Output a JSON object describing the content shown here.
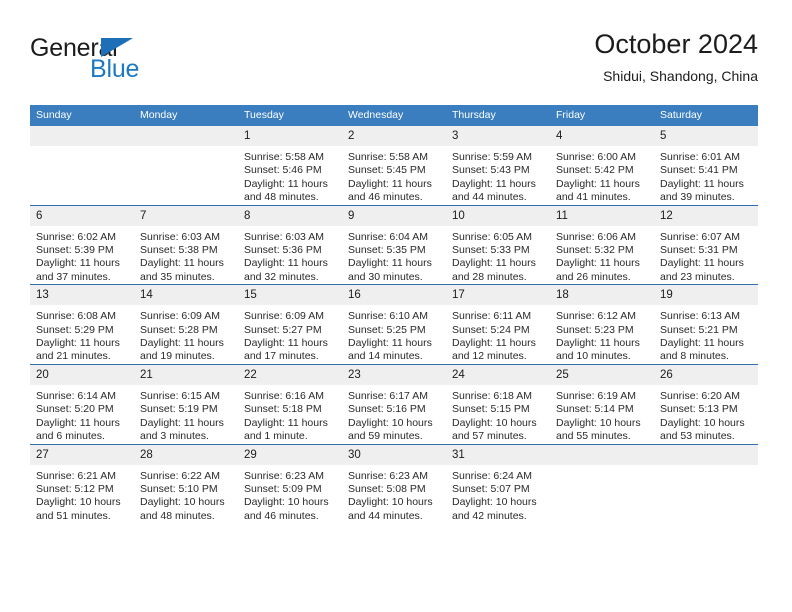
{
  "brand": {
    "name_top": "General",
    "name_bottom": "Blue",
    "accent_color": "#1d79c4",
    "triangle_color": "#1d6fb8"
  },
  "header": {
    "title": "October 2024",
    "subtitle": "Shidui, Shandong, China",
    "header_bg": "#3a7ebf",
    "header_text_color": "#ffffff",
    "daynum_bg": "#efefef",
    "row_divider_color": "#2f6fae"
  },
  "weekdays": [
    "Sunday",
    "Monday",
    "Tuesday",
    "Wednesday",
    "Thursday",
    "Friday",
    "Saturday"
  ],
  "weeks": [
    [
      {
        "day": "",
        "sunrise": "",
        "sunset": "",
        "daylight1": "",
        "daylight2": ""
      },
      {
        "day": "",
        "sunrise": "",
        "sunset": "",
        "daylight1": "",
        "daylight2": ""
      },
      {
        "day": "1",
        "sunrise": "Sunrise: 5:58 AM",
        "sunset": "Sunset: 5:46 PM",
        "daylight1": "Daylight: 11 hours",
        "daylight2": "and 48 minutes."
      },
      {
        "day": "2",
        "sunrise": "Sunrise: 5:58 AM",
        "sunset": "Sunset: 5:45 PM",
        "daylight1": "Daylight: 11 hours",
        "daylight2": "and 46 minutes."
      },
      {
        "day": "3",
        "sunrise": "Sunrise: 5:59 AM",
        "sunset": "Sunset: 5:43 PM",
        "daylight1": "Daylight: 11 hours",
        "daylight2": "and 44 minutes."
      },
      {
        "day": "4",
        "sunrise": "Sunrise: 6:00 AM",
        "sunset": "Sunset: 5:42 PM",
        "daylight1": "Daylight: 11 hours",
        "daylight2": "and 41 minutes."
      },
      {
        "day": "5",
        "sunrise": "Sunrise: 6:01 AM",
        "sunset": "Sunset: 5:41 PM",
        "daylight1": "Daylight: 11 hours",
        "daylight2": "and 39 minutes."
      }
    ],
    [
      {
        "day": "6",
        "sunrise": "Sunrise: 6:02 AM",
        "sunset": "Sunset: 5:39 PM",
        "daylight1": "Daylight: 11 hours",
        "daylight2": "and 37 minutes."
      },
      {
        "day": "7",
        "sunrise": "Sunrise: 6:03 AM",
        "sunset": "Sunset: 5:38 PM",
        "daylight1": "Daylight: 11 hours",
        "daylight2": "and 35 minutes."
      },
      {
        "day": "8",
        "sunrise": "Sunrise: 6:03 AM",
        "sunset": "Sunset: 5:36 PM",
        "daylight1": "Daylight: 11 hours",
        "daylight2": "and 32 minutes."
      },
      {
        "day": "9",
        "sunrise": "Sunrise: 6:04 AM",
        "sunset": "Sunset: 5:35 PM",
        "daylight1": "Daylight: 11 hours",
        "daylight2": "and 30 minutes."
      },
      {
        "day": "10",
        "sunrise": "Sunrise: 6:05 AM",
        "sunset": "Sunset: 5:33 PM",
        "daylight1": "Daylight: 11 hours",
        "daylight2": "and 28 minutes."
      },
      {
        "day": "11",
        "sunrise": "Sunrise: 6:06 AM",
        "sunset": "Sunset: 5:32 PM",
        "daylight1": "Daylight: 11 hours",
        "daylight2": "and 26 minutes."
      },
      {
        "day": "12",
        "sunrise": "Sunrise: 6:07 AM",
        "sunset": "Sunset: 5:31 PM",
        "daylight1": "Daylight: 11 hours",
        "daylight2": "and 23 minutes."
      }
    ],
    [
      {
        "day": "13",
        "sunrise": "Sunrise: 6:08 AM",
        "sunset": "Sunset: 5:29 PM",
        "daylight1": "Daylight: 11 hours",
        "daylight2": "and 21 minutes."
      },
      {
        "day": "14",
        "sunrise": "Sunrise: 6:09 AM",
        "sunset": "Sunset: 5:28 PM",
        "daylight1": "Daylight: 11 hours",
        "daylight2": "and 19 minutes."
      },
      {
        "day": "15",
        "sunrise": "Sunrise: 6:09 AM",
        "sunset": "Sunset: 5:27 PM",
        "daylight1": "Daylight: 11 hours",
        "daylight2": "and 17 minutes."
      },
      {
        "day": "16",
        "sunrise": "Sunrise: 6:10 AM",
        "sunset": "Sunset: 5:25 PM",
        "daylight1": "Daylight: 11 hours",
        "daylight2": "and 14 minutes."
      },
      {
        "day": "17",
        "sunrise": "Sunrise: 6:11 AM",
        "sunset": "Sunset: 5:24 PM",
        "daylight1": "Daylight: 11 hours",
        "daylight2": "and 12 minutes."
      },
      {
        "day": "18",
        "sunrise": "Sunrise: 6:12 AM",
        "sunset": "Sunset: 5:23 PM",
        "daylight1": "Daylight: 11 hours",
        "daylight2": "and 10 minutes."
      },
      {
        "day": "19",
        "sunrise": "Sunrise: 6:13 AM",
        "sunset": "Sunset: 5:21 PM",
        "daylight1": "Daylight: 11 hours",
        "daylight2": "and 8 minutes."
      }
    ],
    [
      {
        "day": "20",
        "sunrise": "Sunrise: 6:14 AM",
        "sunset": "Sunset: 5:20 PM",
        "daylight1": "Daylight: 11 hours",
        "daylight2": "and 6 minutes."
      },
      {
        "day": "21",
        "sunrise": "Sunrise: 6:15 AM",
        "sunset": "Sunset: 5:19 PM",
        "daylight1": "Daylight: 11 hours",
        "daylight2": "and 3 minutes."
      },
      {
        "day": "22",
        "sunrise": "Sunrise: 6:16 AM",
        "sunset": "Sunset: 5:18 PM",
        "daylight1": "Daylight: 11 hours",
        "daylight2": "and 1 minute."
      },
      {
        "day": "23",
        "sunrise": "Sunrise: 6:17 AM",
        "sunset": "Sunset: 5:16 PM",
        "daylight1": "Daylight: 10 hours",
        "daylight2": "and 59 minutes."
      },
      {
        "day": "24",
        "sunrise": "Sunrise: 6:18 AM",
        "sunset": "Sunset: 5:15 PM",
        "daylight1": "Daylight: 10 hours",
        "daylight2": "and 57 minutes."
      },
      {
        "day": "25",
        "sunrise": "Sunrise: 6:19 AM",
        "sunset": "Sunset: 5:14 PM",
        "daylight1": "Daylight: 10 hours",
        "daylight2": "and 55 minutes."
      },
      {
        "day": "26",
        "sunrise": "Sunrise: 6:20 AM",
        "sunset": "Sunset: 5:13 PM",
        "daylight1": "Daylight: 10 hours",
        "daylight2": "and 53 minutes."
      }
    ],
    [
      {
        "day": "27",
        "sunrise": "Sunrise: 6:21 AM",
        "sunset": "Sunset: 5:12 PM",
        "daylight1": "Daylight: 10 hours",
        "daylight2": "and 51 minutes."
      },
      {
        "day": "28",
        "sunrise": "Sunrise: 6:22 AM",
        "sunset": "Sunset: 5:10 PM",
        "daylight1": "Daylight: 10 hours",
        "daylight2": "and 48 minutes."
      },
      {
        "day": "29",
        "sunrise": "Sunrise: 6:23 AM",
        "sunset": "Sunset: 5:09 PM",
        "daylight1": "Daylight: 10 hours",
        "daylight2": "and 46 minutes."
      },
      {
        "day": "30",
        "sunrise": "Sunrise: 6:23 AM",
        "sunset": "Sunset: 5:08 PM",
        "daylight1": "Daylight: 10 hours",
        "daylight2": "and 44 minutes."
      },
      {
        "day": "31",
        "sunrise": "Sunrise: 6:24 AM",
        "sunset": "Sunset: 5:07 PM",
        "daylight1": "Daylight: 10 hours",
        "daylight2": "and 42 minutes."
      },
      {
        "day": "",
        "sunrise": "",
        "sunset": "",
        "daylight1": "",
        "daylight2": ""
      },
      {
        "day": "",
        "sunrise": "",
        "sunset": "",
        "daylight1": "",
        "daylight2": ""
      }
    ]
  ]
}
